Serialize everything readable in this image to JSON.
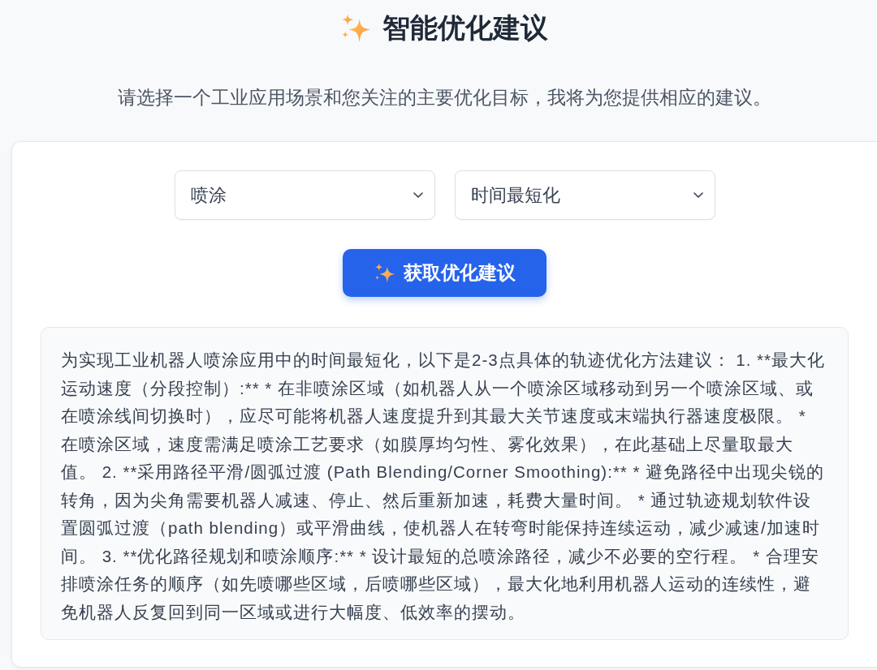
{
  "header": {
    "title": "智能优化建议",
    "subtitle": "请选择一个工业应用场景和您关注的主要优化目标，我将为您提供相应的建议。"
  },
  "form": {
    "selects": [
      {
        "value": "喷涂"
      },
      {
        "value": "时间最短化"
      }
    ],
    "submit_button": {
      "label": "获取优化建议"
    }
  },
  "result": {
    "text": "为实现工业机器人喷涂应用中的时间最短化，以下是2-3点具体的轨迹优化方法建议： 1. **最大化运动速度（分段控制）:** * 在非喷涂区域（如机器人从一个喷涂区域移动到另一个喷涂区域、或在喷涂线间切换时），应尽可能将机器人速度提升到其最大关节速度或末端执行器速度极限。 * 在喷涂区域，速度需满足喷涂工艺要求（如膜厚均匀性、雾化效果），在此基础上尽量取最大值。 2. **采用路径平滑/圆弧过渡 (Path Blending/Corner Smoothing):** * 避免路径中出现尖锐的转角，因为尖角需要机器人减速、停止、然后重新加速，耗费大量时间。 * 通过轨迹规划软件设置圆弧过渡（path blending）或平滑曲线，使机器人在转弯时能保持连续运动，减少减速/加速时间。 3. **优化路径规划和喷涂顺序:** * 设计最短的总喷涂路径，减少不必要的空行程。 * 合理安排喷涂任务的顺序（如先喷哪些区域，后喷哪些区域），最大化地利用机器人运动的连续性，避免机器人反复回到同一区域或进行大幅度、低效率的摆动。"
  }
}
